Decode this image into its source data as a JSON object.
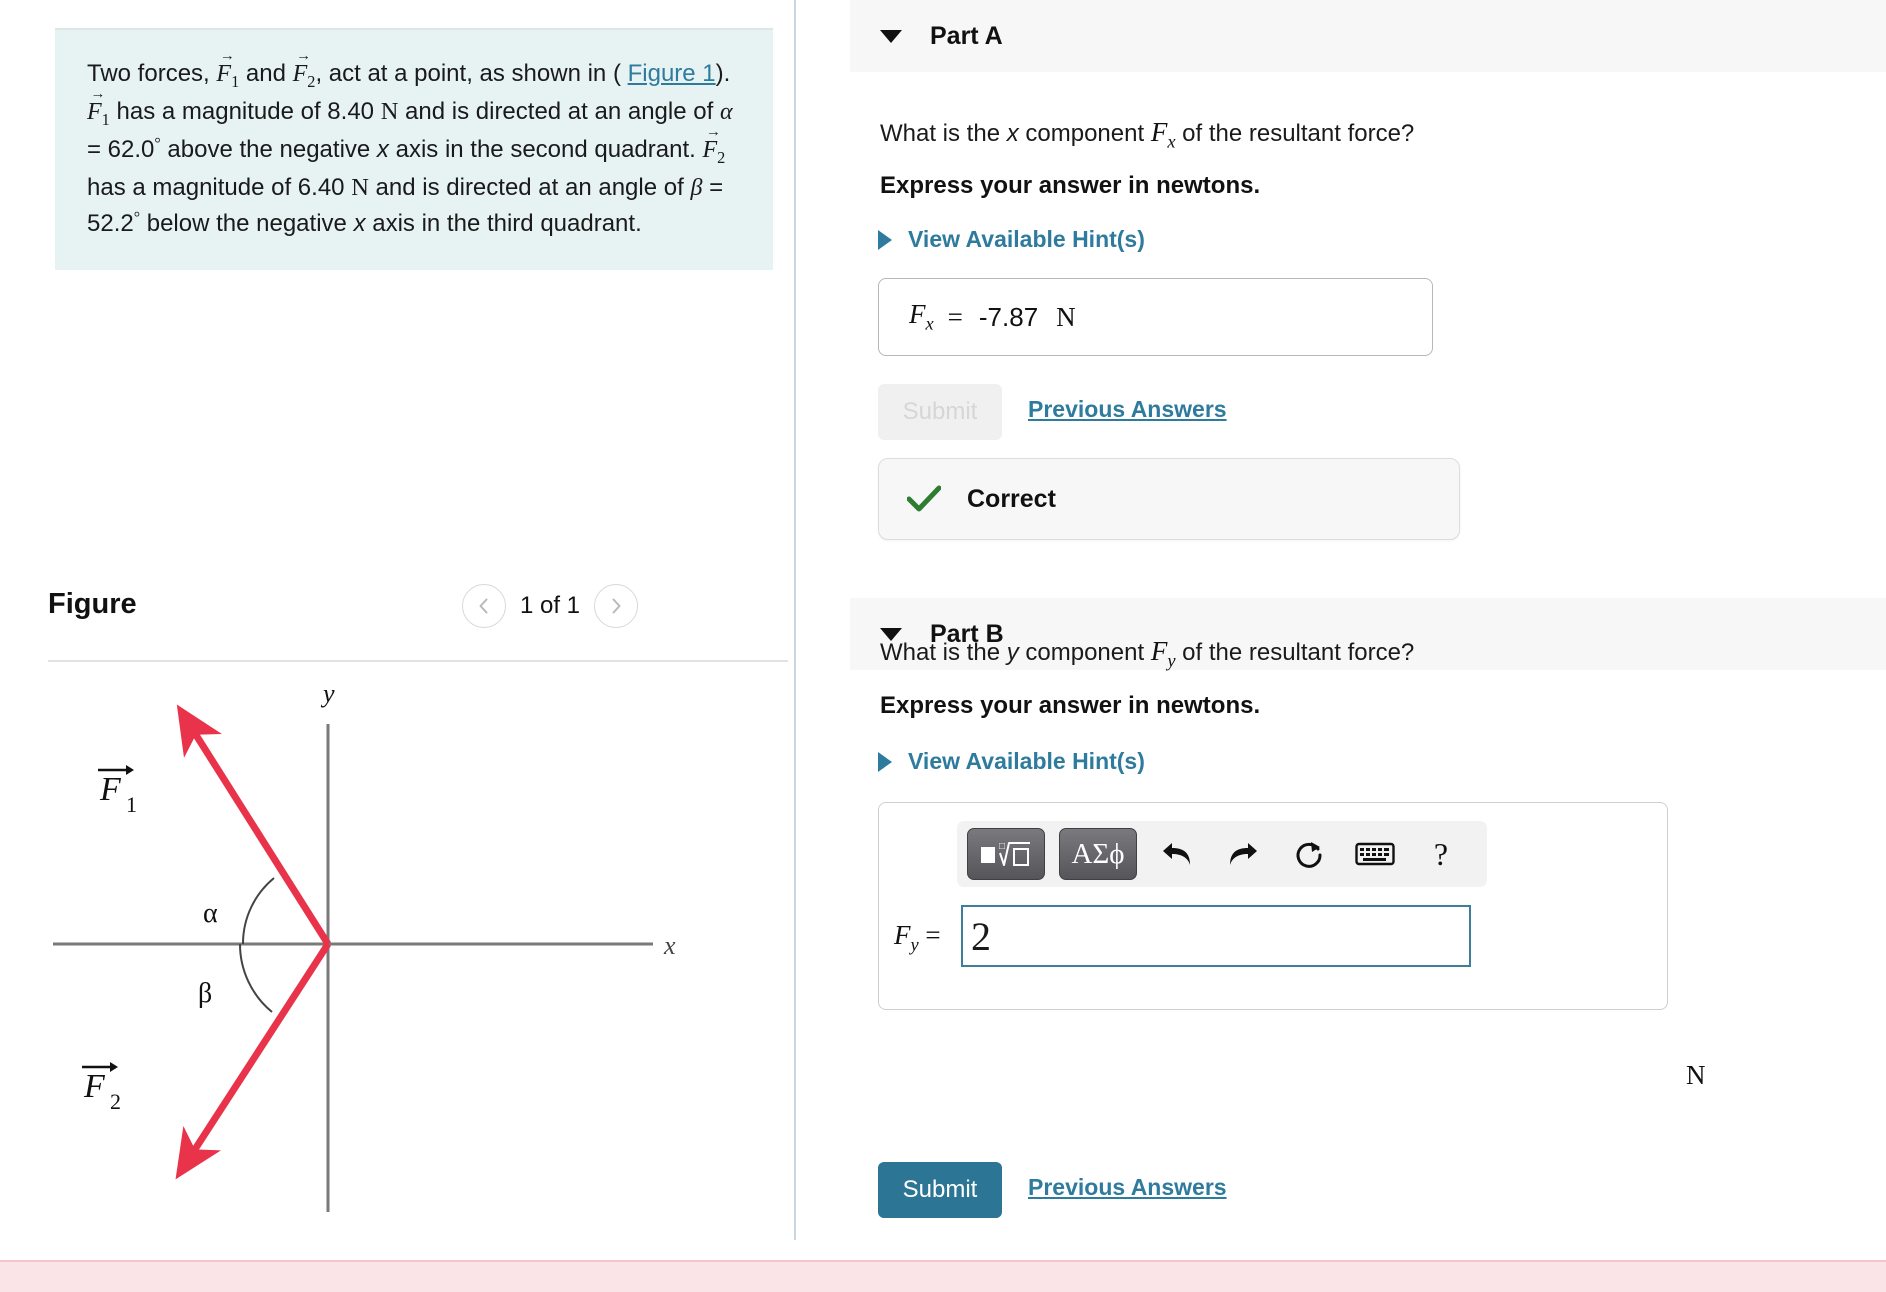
{
  "problem": {
    "intro": "Two forces,",
    "f1_label": "F",
    "f1_sub": "1",
    "f2_label": "F",
    "f2_sub": "2",
    "text_and": "and",
    "text_act": ", act at a point, as shown in (",
    "figure_link": "Figure 1",
    "text_after_link": ").",
    "f1_mag_text": "has a magnitude of 8.40",
    "unit_newton": "N",
    "text_directed": "and is directed at an angle of",
    "alpha_symbol": "α",
    "alpha_value": "= 62.0",
    "degree": "°",
    "text_above": "above the negative",
    "axis_x": "x",
    "text_axis_second": "axis in the second quadrant.",
    "f2_mag_text": "has a magnitude of 6.40",
    "text_and_is": "and is directed at an angle of",
    "beta_symbol": "β",
    "beta_value": "= 52.2",
    "text_below": "below the negative",
    "text_axis_third": "axis in the third quadrant."
  },
  "figure": {
    "title": "Figure",
    "count": "1 of 1",
    "prev_icon": "chevron-left-icon",
    "next_icon": "chevron-right-icon",
    "axis_x_label": "x",
    "axis_y_label": "y",
    "vector1_label": "F",
    "vector1_sub": "1",
    "vector2_label": "F",
    "vector2_sub": "2",
    "angle_alpha": "α",
    "angle_beta": "β",
    "vector_color": "#e8334a",
    "axis_color": "#7a7a7a"
  },
  "parts": [
    {
      "id": "part-a",
      "title": "Part A",
      "caret": "caret-down-icon",
      "question_pre": "What is the",
      "question_var": "x",
      "question_mid": "component",
      "question_sym": "F",
      "question_sym_sub": "x",
      "question_post": "of the resultant force?",
      "instruction": "Express your answer in newtons.",
      "hint_label": "View Available Hint(s)",
      "answer_symbol": "F",
      "answer_symbol_sub": "x",
      "equals": "=",
      "answer_value": "-7.87",
      "answer_unit": "N",
      "submit_label": "Submit",
      "submit_enabled": false,
      "previous_answers_label": "Previous Answers",
      "status": "Correct",
      "status_icon": "check-icon",
      "status_color": "#2e7d32"
    },
    {
      "id": "part-b",
      "title": "Part B",
      "caret": "caret-down-icon",
      "question_pre": "What is the",
      "question_var": "y",
      "question_mid": "component",
      "question_sym": "F",
      "question_sym_sub": "y",
      "question_post": "of the resultant force?",
      "instruction": "Express your answer in newtons.",
      "hint_label": "View Available Hint(s)",
      "answer_symbol": "F",
      "answer_symbol_sub": "y",
      "equals": "=",
      "input_value": "2",
      "answer_unit": "N",
      "submit_label": "Submit",
      "submit_enabled": true,
      "previous_answers_label": "Previous Answers",
      "toolbar": [
        {
          "name": "math-template-button",
          "glyph": "√",
          "type": "key"
        },
        {
          "name": "greek-letters-button",
          "glyph": "ΑΣϕ",
          "type": "key"
        },
        {
          "name": "undo-icon",
          "glyph": "↶",
          "type": "icon"
        },
        {
          "name": "redo-icon",
          "glyph": "↷",
          "type": "icon"
        },
        {
          "name": "reset-icon",
          "glyph": "↻",
          "type": "icon"
        },
        {
          "name": "keyboard-icon",
          "glyph": "⌨",
          "type": "icon"
        },
        {
          "name": "help-icon",
          "glyph": "?",
          "type": "icon"
        }
      ]
    }
  ],
  "colors": {
    "accent_link": "#2e7b9e",
    "submit_active": "#2d7595",
    "statement_bg": "#e7f3f3",
    "part_header_bg": "#f7f7f7",
    "bottom_band": "#fae4e7"
  }
}
